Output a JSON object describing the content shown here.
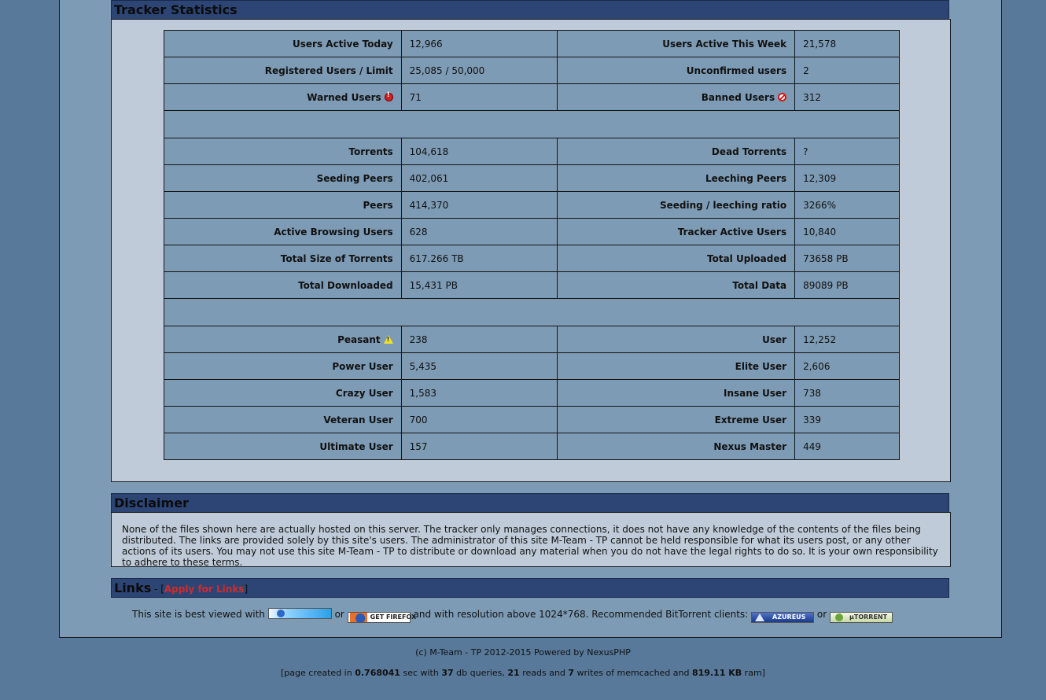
{
  "stats": {
    "title": "Tracker Statistics",
    "rows": [
      {
        "l1": "Users Active Today",
        "v1": "12,966",
        "l2": "Users Active This Week",
        "v2": "21,578"
      },
      {
        "l1": "Registered Users / Limit",
        "v1": "25,085 / 50,000",
        "l2": "Unconfirmed users",
        "v2": "2"
      },
      {
        "l1": "Warned Users",
        "v1": "71",
        "l2": "Banned Users",
        "v2": "312"
      },
      {
        "l1": "Torrents",
        "v1": "104,618",
        "l2": "Dead Torrents",
        "v2": "?"
      },
      {
        "l1": "Seeding Peers",
        "v1": "402,061",
        "l2": "Leeching Peers",
        "v2": "12,309"
      },
      {
        "l1": "Peers",
        "v1": "414,370",
        "l2": "Seeding / leeching ratio",
        "v2": "3266%"
      },
      {
        "l1": "Active Browsing Users",
        "v1": "628",
        "l2": "Tracker Active Users",
        "v2": "10,840"
      },
      {
        "l1": "Total Size of Torrents",
        "v1": "617.266 TB",
        "l2": "Total Uploaded",
        "v2": "73658 PB"
      },
      {
        "l1": "Total Downloaded",
        "v1": "15,431 PB",
        "l2": "Total Data",
        "v2": "89089 PB"
      },
      {
        "l1": "Peasant",
        "v1": "238",
        "l2": "User",
        "v2": "12,252"
      },
      {
        "l1": "Power User",
        "v1": "5,435",
        "l2": "Elite User",
        "v2": "2,606"
      },
      {
        "l1": "Crazy User",
        "v1": "1,583",
        "l2": "Insane User",
        "v2": "738"
      },
      {
        "l1": "Veteran User",
        "v1": "700",
        "l2": "Extreme User",
        "v2": "339"
      },
      {
        "l1": "Ultimate User",
        "v1": "157",
        "l2": "Nexus Master",
        "v2": "449"
      }
    ]
  },
  "disclaimer": {
    "title": "Disclaimer",
    "text": "None of the files shown here are actually hosted on this server. The tracker only manages connections, it does not have any knowledge of the contents of the files being distributed. The links are provided solely by this site's users. The administrator of this site M-Team - TP cannot be held responsible for what its users post, or any other actions of its users. You may not use this site M-Team - TP to distribute or download any material when you do not have the legal rights to do so. It is your own responsibility to adhere to these terms."
  },
  "links": {
    "title": "Links",
    "dash": " - [",
    "apply_label": "Apply for Links",
    "close": "]",
    "best_viewed": "This site is best viewed with",
    "or1": "or",
    "firefox_badge": "GET FIREFOX",
    "resolution_text": "and with resolution above 1024*768. Recommended BitTorrent clients:",
    "azureus_badge": "AZUREUS",
    "or2": "or",
    "utorrent_badge": "µTORRENT"
  },
  "footer": {
    "copyright": "(c) M-Team - TP 2012-2015 Powered by NexusPHP",
    "p1": "[page created in ",
    "time": "0.768041",
    "p2": " sec with ",
    "queries": "37",
    "p3": " db queries, ",
    "reads": "21",
    "p4": " reads and ",
    "writes": "7",
    "p5": " writes of memcached and ",
    "ram": "819.11 KB",
    "p6": " ram]"
  },
  "colors": {
    "page_bg": "#58799a",
    "panel_bg": "#7d9bb4",
    "header_bg": "#2c4575",
    "body_bg": "#bfcbd8",
    "link_red": "#d42a2a"
  },
  "icons": {
    "warned": "warning-circle-icon",
    "banned": "banned-icon",
    "peasant": "warning-triangle-icon"
  }
}
